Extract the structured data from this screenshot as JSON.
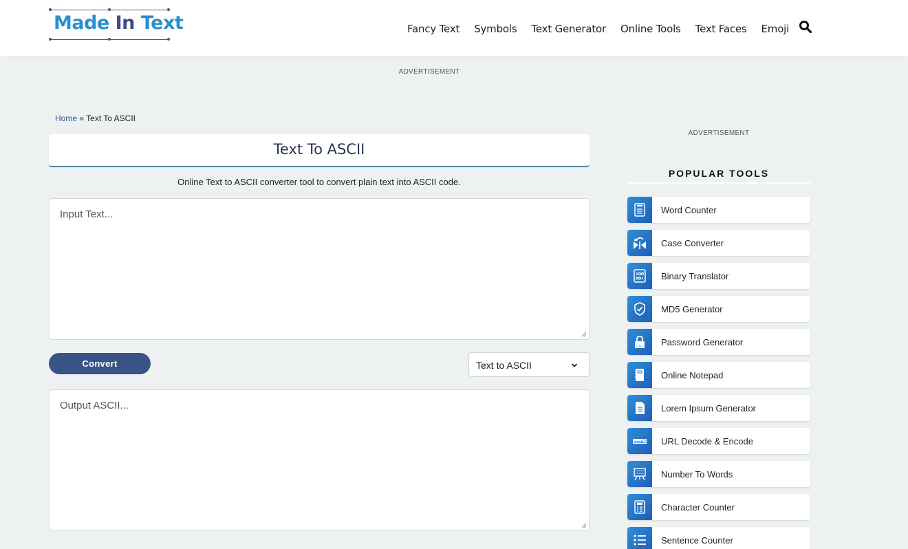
{
  "header": {
    "logo": {
      "part1": "Made",
      "part2": "In",
      "part3": "Text"
    },
    "nav": [
      "Fancy Text",
      "Symbols",
      "Text Generator",
      "Online Tools",
      "Text Faces",
      "Emoji"
    ]
  },
  "ads": {
    "top": "ADVERTISEMENT",
    "side": "ADVERTISEMENT"
  },
  "breadcrumb": {
    "home": "Home",
    "sep": "»",
    "current": "Text To ASCII"
  },
  "page": {
    "title": "Text To ASCII",
    "description": "Online Text to ASCII converter tool to convert plain text into ASCII code.",
    "input_placeholder": "Input Text...",
    "output_placeholder": "Output ASCII...",
    "convert_label": "Convert",
    "mode_selected": "Text to ASCII"
  },
  "sidebar": {
    "heading": "POPULAR TOOLS",
    "tools": [
      {
        "label": "Word Counter",
        "icon": "word-counter-icon"
      },
      {
        "label": "Case Converter",
        "icon": "case-converter-icon"
      },
      {
        "label": "Binary Translator",
        "icon": "binary-icon"
      },
      {
        "label": "MD5 Generator",
        "icon": "shield-check-icon"
      },
      {
        "label": "Password Generator",
        "icon": "lock-icon"
      },
      {
        "label": "Online Notepad",
        "icon": "notepad-icon"
      },
      {
        "label": "Lorem Ipsum Generator",
        "icon": "document-icon"
      },
      {
        "label": "URL Decode & Encode",
        "icon": "url-icon"
      },
      {
        "label": "Number To Words",
        "icon": "number-board-icon"
      },
      {
        "label": "Character Counter",
        "icon": "character-counter-icon"
      },
      {
        "label": "Sentence Counter",
        "icon": "list-icon"
      }
    ]
  },
  "colors": {
    "brand_blue": "#2b8fce",
    "brand_navy": "#3a4a86",
    "button": "#3a5386",
    "icon_gradient": "#2f8fd6"
  }
}
